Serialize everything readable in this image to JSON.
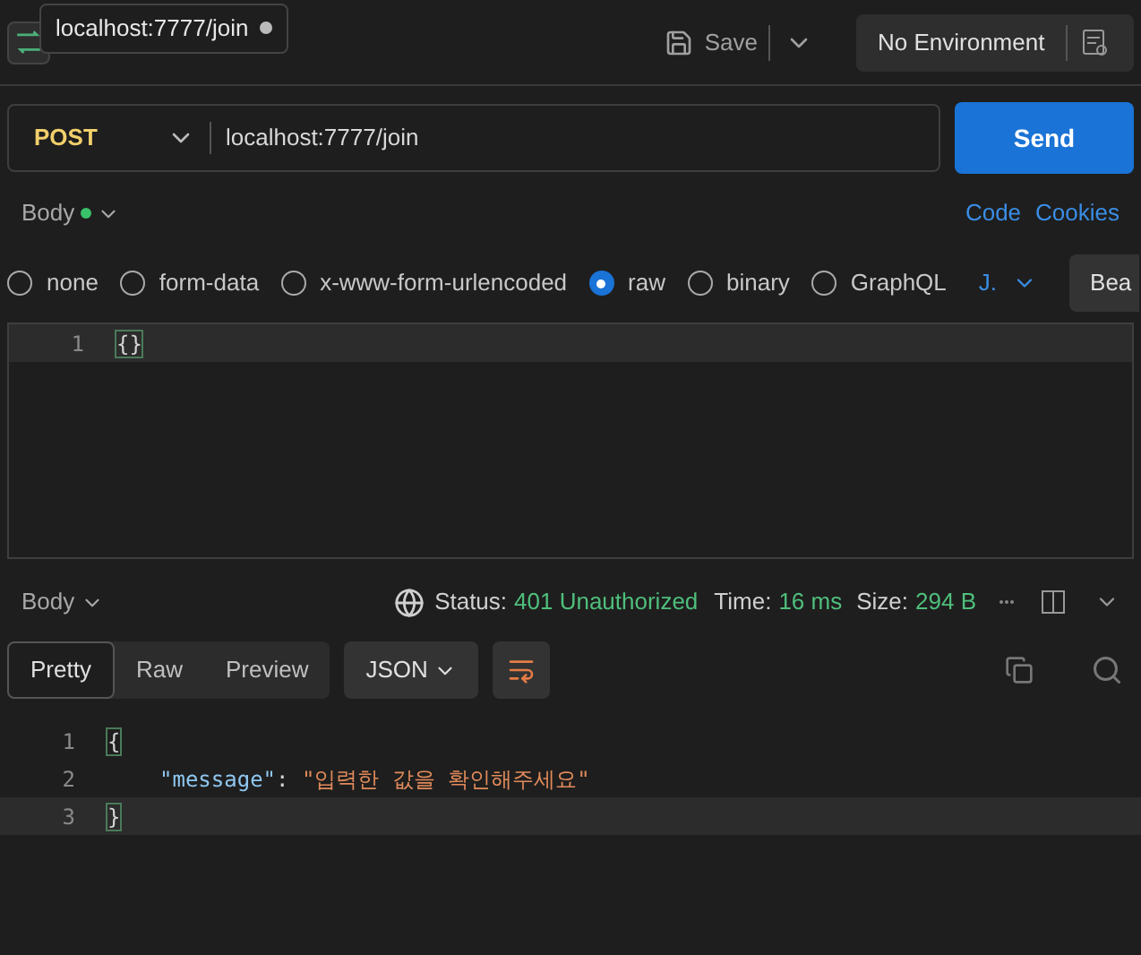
{
  "tooltip": {
    "text": "localhost:7777/join"
  },
  "header": {
    "save": "Save",
    "environment": "No Environment"
  },
  "request": {
    "method": "POST",
    "url": "localhost:7777/join",
    "send": "Send"
  },
  "body_bar": {
    "label": "Body",
    "links": [
      "Code",
      "Cookies"
    ]
  },
  "body_types": [
    {
      "label": "none",
      "selected": false
    },
    {
      "label": "form-data",
      "selected": false
    },
    {
      "label": "x-www-form-urlencoded",
      "selected": false
    },
    {
      "label": "raw",
      "selected": true
    },
    {
      "label": "binary",
      "selected": false
    },
    {
      "label": "GraphQL",
      "selected": false
    }
  ],
  "language": "J.",
  "beautify": "Bea",
  "editor": {
    "lines": [
      {
        "number": "1",
        "tokens": [
          {
            "text": "{}",
            "kind": "brace"
          }
        ]
      }
    ]
  },
  "response": {
    "label": "Body",
    "status_label": "Status:",
    "status": "401 Unauthorized",
    "time_label": "Time:",
    "time": "16 ms",
    "size_label": "Size:",
    "size": "294 B",
    "views": [
      {
        "label": "Pretty",
        "selected": true
      },
      {
        "label": "Raw",
        "selected": false
      },
      {
        "label": "Preview",
        "selected": false
      }
    ],
    "format": "JSON",
    "lines": [
      {
        "number": "1",
        "tokens": [
          {
            "text": "{",
            "kind": "brace"
          }
        ]
      },
      {
        "number": "2",
        "indented": true,
        "tokens": [
          {
            "text": "\"message\"",
            "kind": "key"
          },
          {
            "text": ": ",
            "kind": "punct"
          },
          {
            "text": "\"입력한 값을 확인해주세요\"",
            "kind": "string"
          }
        ]
      },
      {
        "number": "3",
        "tokens": [
          {
            "text": "}",
            "kind": "brace"
          }
        ]
      }
    ]
  }
}
